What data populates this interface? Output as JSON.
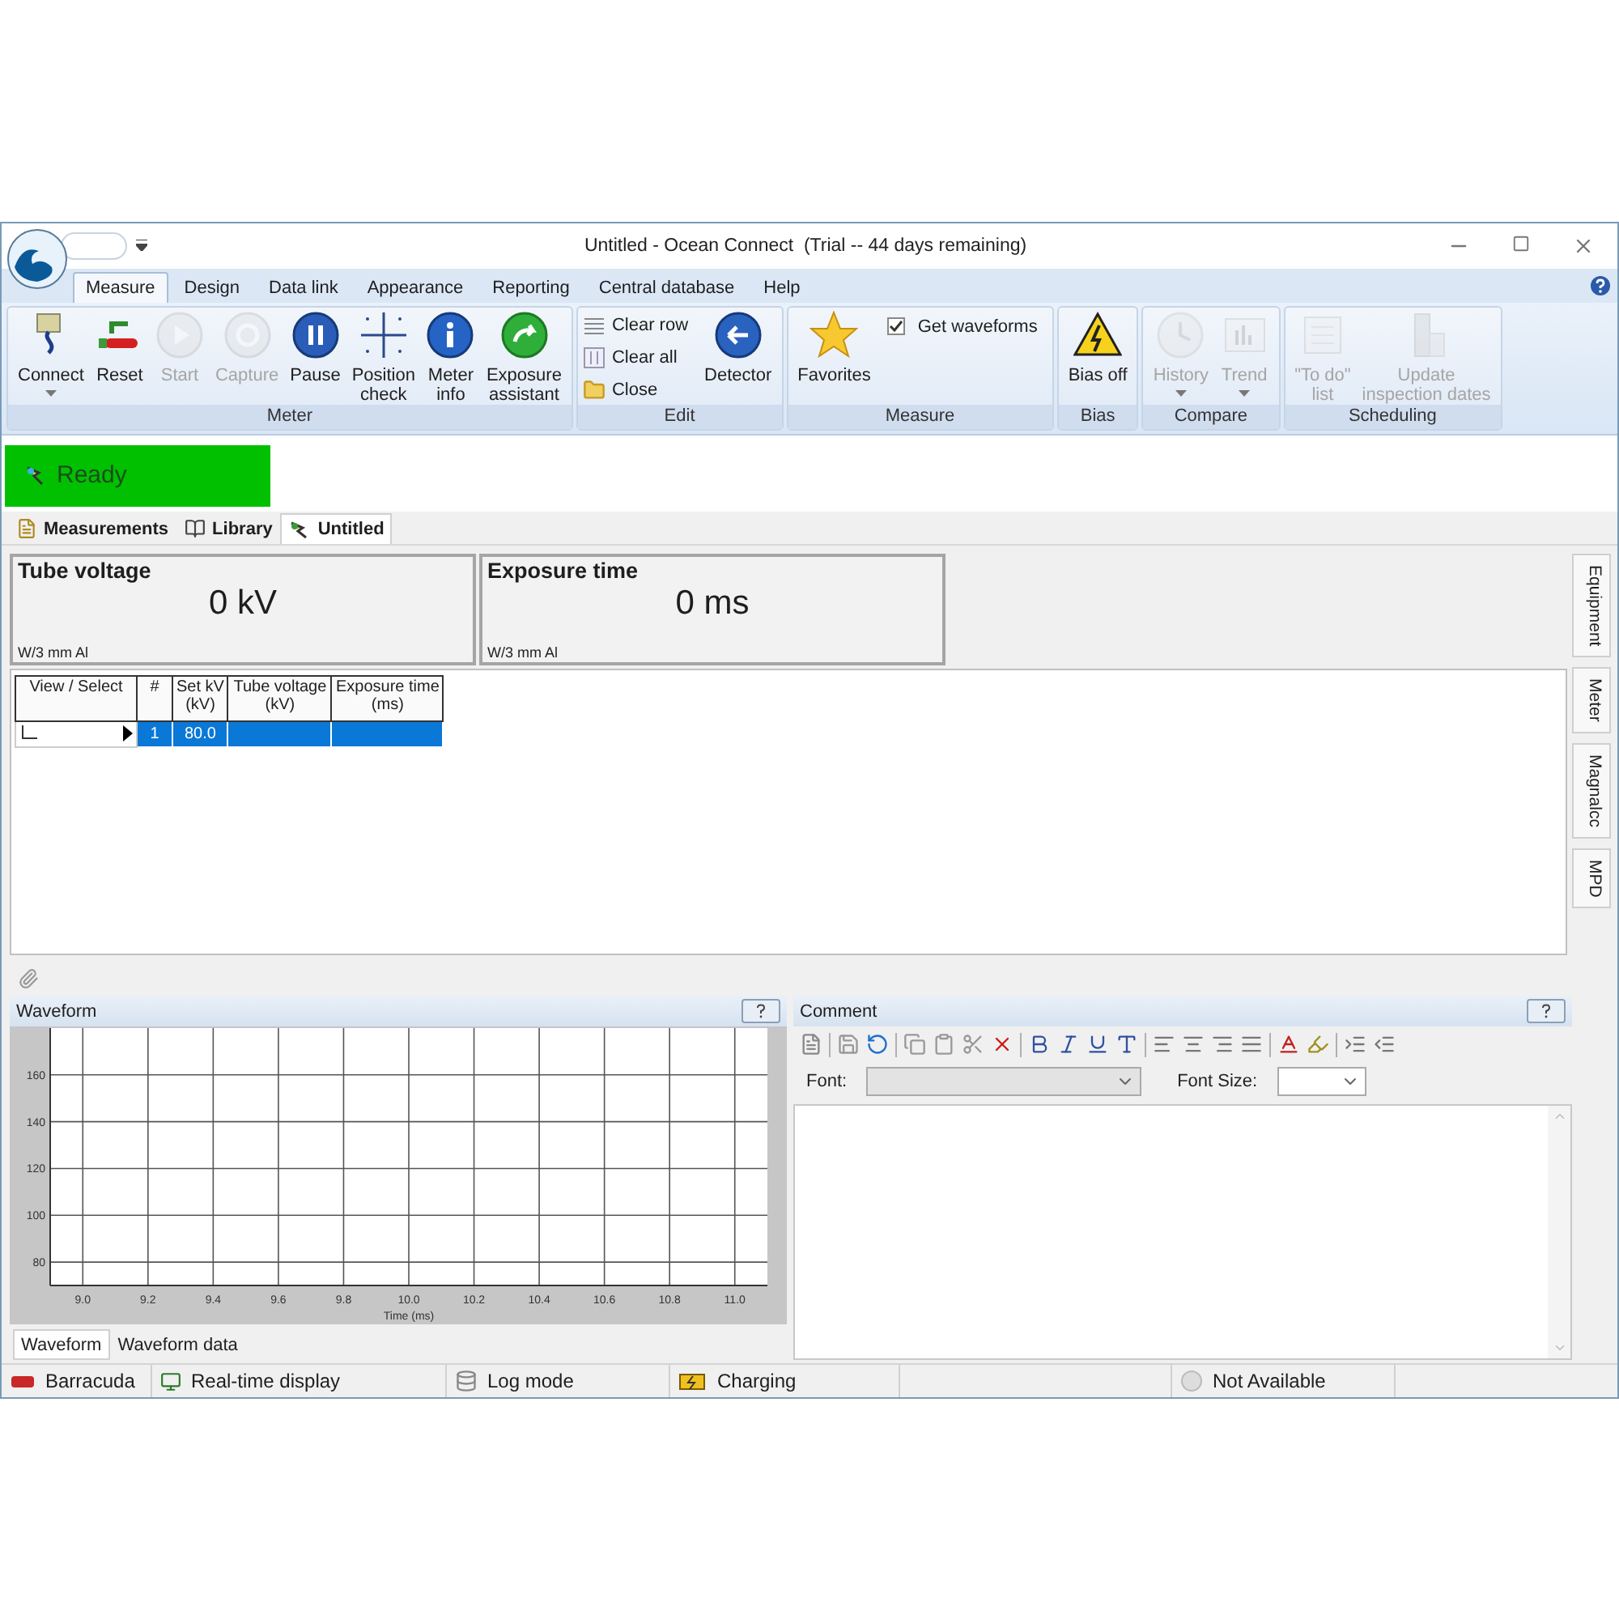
{
  "window": {
    "title": "Untitled - Ocean Connect  (Trial -- 44 days remaining)"
  },
  "ribbon": {
    "tabs": [
      {
        "label": "Measure",
        "selected": true
      },
      {
        "label": "Design",
        "selected": false
      },
      {
        "label": "Data link",
        "selected": false
      },
      {
        "label": "Appearance",
        "selected": false
      },
      {
        "label": "Reporting",
        "selected": false
      },
      {
        "label": "Central database",
        "selected": false
      },
      {
        "label": "Help",
        "selected": false
      }
    ],
    "groups": [
      {
        "label": "Meter",
        "items": [
          {
            "kind": "large",
            "label": "Connect",
            "disabled": false,
            "dropdown": true
          },
          {
            "kind": "large",
            "label": "Reset",
            "disabled": false,
            "dropdown": false
          },
          {
            "kind": "large",
            "label": "Start",
            "disabled": true,
            "dropdown": false
          },
          {
            "kind": "large",
            "label": "Capture",
            "disabled": true,
            "dropdown": false
          },
          {
            "kind": "large",
            "label": "Pause",
            "disabled": false,
            "dropdown": false
          },
          {
            "kind": "large",
            "label": "Position\ncheck",
            "disabled": false,
            "dropdown": false
          },
          {
            "kind": "large",
            "label": "Meter\ninfo",
            "disabled": false,
            "dropdown": false
          },
          {
            "kind": "large",
            "label": "Exposure\nassistant",
            "disabled": false,
            "dropdown": false
          }
        ]
      },
      {
        "label": "Edit",
        "items": [
          {
            "kind": "small",
            "label": "Clear row",
            "disabled": false
          },
          {
            "kind": "small",
            "label": "Clear all",
            "disabled": false
          },
          {
            "kind": "small",
            "label": "Close",
            "disabled": false
          },
          {
            "kind": "large",
            "label": "Detector",
            "disabled": false,
            "dropdown": false
          }
        ]
      },
      {
        "label": "Measure",
        "items": [
          {
            "kind": "large",
            "label": "Favorites",
            "disabled": false,
            "dropdown": false
          },
          {
            "kind": "check",
            "label": "Get waveforms",
            "checked": true
          }
        ]
      },
      {
        "label": "Bias",
        "items": [
          {
            "kind": "large",
            "label": "Bias off",
            "disabled": false,
            "dropdown": false
          }
        ]
      },
      {
        "label": "Compare",
        "items": [
          {
            "kind": "large",
            "label": "History",
            "disabled": true,
            "dropdown": true
          },
          {
            "kind": "large",
            "label": "Trend",
            "disabled": true,
            "dropdown": true
          }
        ]
      },
      {
        "label": "Scheduling",
        "items": [
          {
            "kind": "large",
            "label": "\"To do\"\nlist",
            "disabled": true,
            "dropdown": false
          },
          {
            "kind": "large",
            "label": "Update\ninspection dates",
            "disabled": true,
            "dropdown": false
          }
        ]
      }
    ]
  },
  "status": {
    "label": "Ready"
  },
  "document_tabs": [
    {
      "label": "Measurements",
      "selected": false
    },
    {
      "label": "Library",
      "selected": false
    },
    {
      "label": "Untitled",
      "selected": true
    }
  ],
  "readouts": [
    {
      "title": "Tube voltage",
      "value": "0 kV",
      "filter": "W/3 mm Al"
    },
    {
      "title": "Exposure time",
      "value": "0 ms",
      "filter": "W/3 mm Al"
    }
  ],
  "table": {
    "columns": [
      "View / Select",
      "#",
      "Set kV\n(kV)",
      "Tube voltage\n(kV)",
      "Exposure time\n(ms)"
    ],
    "rows": [
      {
        "number": "1",
        "set_kv": "80.0",
        "selected": true,
        "current": true
      }
    ]
  },
  "side_tabs": [
    "Equipment",
    "Meter",
    "Magnalcc",
    "MPD"
  ],
  "waveform": {
    "title": "Waveform",
    "chart_data": {
      "type": "line",
      "xlabel": "Time (ms)",
      "xlim": [
        8.9,
        11.1
      ],
      "ylim": [
        70,
        180
      ],
      "grid": true,
      "xticks": [
        {
          "value": 9,
          "label": "9.0"
        },
        {
          "value": 9.2,
          "label": "9.2"
        },
        {
          "value": 9.4,
          "label": "9.4"
        },
        {
          "value": 9.6,
          "label": "9.6"
        },
        {
          "value": 9.8,
          "label": "9.8"
        },
        {
          "value": 10,
          "label": "10.0"
        },
        {
          "value": 10.2,
          "label": "10.2"
        },
        {
          "value": 10.4,
          "label": "10.4"
        },
        {
          "value": 10.6,
          "label": "10.6"
        },
        {
          "value": 10.8,
          "label": "10.8"
        },
        {
          "value": 11,
          "label": "11.0"
        }
      ],
      "yticks": [
        80,
        100,
        120,
        140,
        160
      ]
    },
    "tabs": [
      {
        "label": "Waveform",
        "selected": true
      },
      {
        "label": "Waveform data",
        "selected": false
      }
    ]
  },
  "comment": {
    "title": "Comment",
    "font_label": "Font:",
    "font_size_label": "Font Size:"
  },
  "status_bar": [
    {
      "label": "Barracuda"
    },
    {
      "label": "Real-time display"
    },
    {
      "label": "Log mode"
    },
    {
      "label": "Charging"
    },
    {
      "label": "Not Available"
    }
  ]
}
